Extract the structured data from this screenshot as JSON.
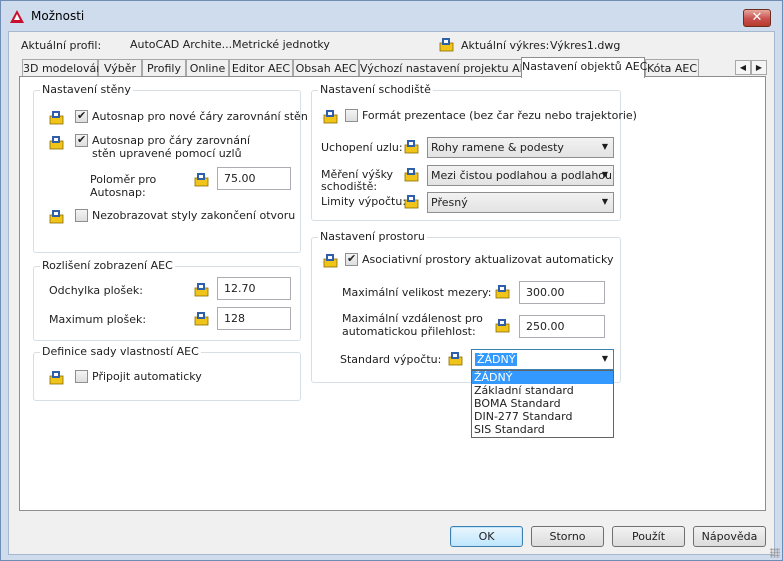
{
  "window": {
    "title": "Možnosti",
    "close_glyph": "✕"
  },
  "header": {
    "profile_label": "Aktuální profil:",
    "profile_value": "AutoCAD Archite...Metrické jednotky",
    "drawing_label": "Aktuální výkres:",
    "drawing_value": "Výkres1.dwg"
  },
  "tabs": [
    "3D modelování",
    "Výběr",
    "Profily",
    "Online",
    "Editor AEC",
    "Obsah AEC",
    "Výchozí nastavení projektu AEC",
    "Nastavení objektů AEC",
    "Kóta AEC"
  ],
  "tab_scroll": {
    "left": "◀",
    "right": "▶"
  },
  "wall": {
    "title": "Nastavení stěny",
    "autosnap_new": "Autosnap pro nové čáry zarovnání stěn",
    "autosnap_nodes": "Autosnap pro čáry zarovnání stěn upravené pomocí uzlů",
    "radius_label": "Poloměr pro Autosnap:",
    "radius_value": "75.00",
    "hide_opening": "Nezobrazovat styly zakončení otvoru"
  },
  "resolution": {
    "title": "Rozlišení zobrazení AEC",
    "facet_dev_label": "Odchylka plošek:",
    "facet_dev_value": "12.70",
    "facet_max_label": "Maximum plošek:",
    "facet_max_value": "128"
  },
  "propset": {
    "title": "Definice sady vlastností AEC",
    "attach_auto": "Připojit automaticky"
  },
  "stair": {
    "title": "Nastavení schodiště",
    "presentation": "Formát prezentace (bez čar řezu nebo trajektorie)",
    "node_snap_label": "Uchopení uzlu:",
    "node_snap_value": "Rohy ramene & podesty",
    "height_label": "Měření výšky schodiště:",
    "height_value": "Mezi čistou podlahou a podlahou",
    "limits_label": "Limity výpočtu:",
    "limits_value": "Přesný"
  },
  "space": {
    "title": "Nastavení prostoru",
    "assoc_update": "Asociativní prostory aktualizovat automaticky",
    "max_gap_label": "Maximální velikost mezery:",
    "max_gap_value": "300.00",
    "max_dist_label": "Maximální vzdálenost pro automatickou přilehlost:",
    "max_dist_value": "250.00",
    "calc_std_label": "Standard výpočtu:",
    "calc_std_value": "ŽÁDNÝ",
    "calc_std_options": [
      "ŽÁDNÝ",
      "Základní standard",
      "BOMA Standard",
      "DIN-277 Standard",
      "SIS Standard"
    ]
  },
  "buttons": {
    "ok": "OK",
    "cancel": "Storno",
    "apply": "Použít",
    "help": "Nápověda"
  },
  "colors": {
    "titlebar": "#cfdced",
    "accent": "#3399ff",
    "close": "#c75050",
    "icon_yellow": "#f0c419",
    "icon_blue": "#2f5fa8"
  }
}
